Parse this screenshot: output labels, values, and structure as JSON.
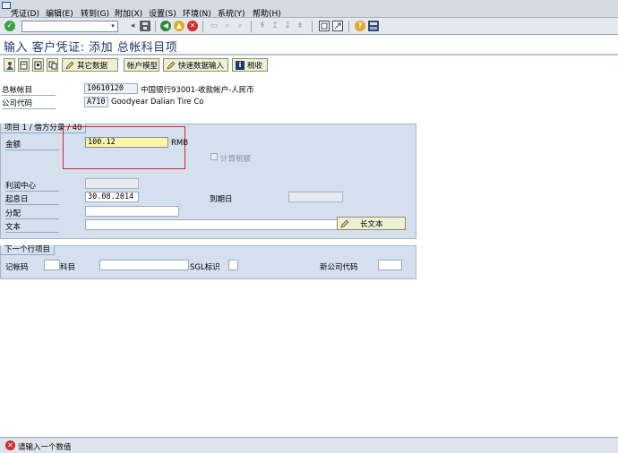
{
  "menu": {
    "items": [
      "凭证(D)",
      "编辑(E)",
      "转到(G)",
      "附加(X)",
      "设置(S)",
      "环境(N)",
      "系统(Y)",
      "帮助(H)"
    ]
  },
  "toolbar": {
    "command_value": ""
  },
  "title": "输入 客户凭证: 添加 总帐科目项",
  "app_toolbar": {
    "other_data": "其它数据",
    "acct_model": "帐户模型",
    "fast_entry": "快速数据输入",
    "tax": "税收"
  },
  "header": {
    "gl_label": "总帐帐目",
    "gl_value": "10610120",
    "gl_desc": "中国银行93001-收款帐户-人民币",
    "company_label": "公司代码",
    "company_value": "A710",
    "company_name": "Goodyear Dalian Tire Co"
  },
  "item": {
    "group_title": "项目 1 / 借方分录 / 40",
    "amount_label": "金额",
    "amount_value": "100.12",
    "currency": "RMB",
    "calc_tax_label": "计算税额",
    "profit_center_label": "利润中心",
    "profit_center_value": "",
    "value_date_label": "起息日",
    "value_date_value": "30.08.2014",
    "due_date_label": "到期日",
    "due_date_value": "",
    "assignment_label": "分配",
    "assignment_value": "",
    "text_label": "文本",
    "text_value": "",
    "long_text_button": "长文本"
  },
  "next_item": {
    "group_title": "下一个行项目",
    "posting_key_label": "记帐码",
    "account_label": "科目",
    "sgl_label": "SGL标识",
    "new_company_label": "新公司代码"
  },
  "status": {
    "message": "请输入一个数值",
    "type": "error"
  },
  "colors": {
    "accent": "#1d3a6c",
    "error": "#d9232c",
    "group_bg": "#d4e0ee",
    "amount_bg": "#fff6a3"
  }
}
